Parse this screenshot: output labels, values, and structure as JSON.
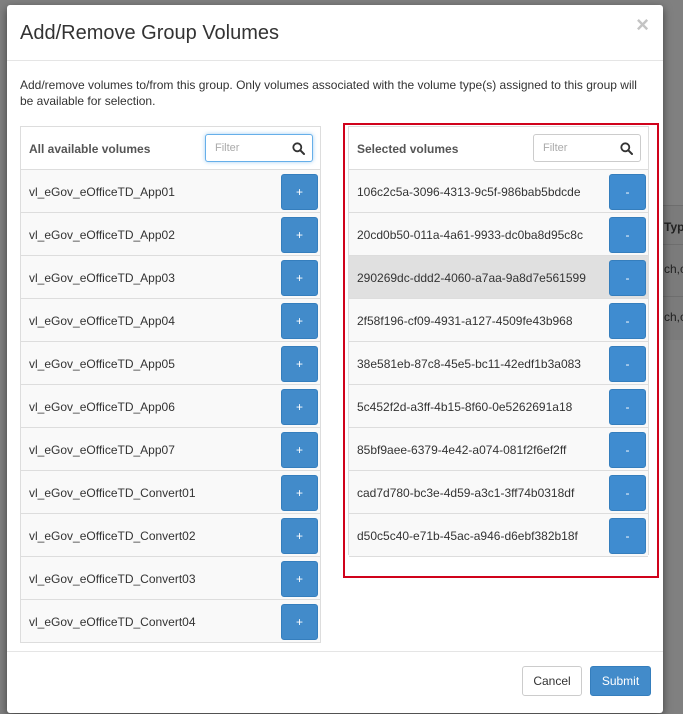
{
  "background": {
    "column_header": "Type",
    "cell_1": "ch,c",
    "cell_2": "ch,c"
  },
  "modal": {
    "title": "Add/Remove Group Volumes",
    "close_symbol": "×",
    "description": "Add/remove volumes to/from this group. Only volumes associated with the volume type(s) assigned to this group will be available for selection."
  },
  "available": {
    "title": "All available volumes",
    "filter_placeholder": "Filter",
    "add_label": "+",
    "items": [
      {
        "label": "vl_eGov_eOfficeTD_App01"
      },
      {
        "label": "vl_eGov_eOfficeTD_App02"
      },
      {
        "label": "vl_eGov_eOfficeTD_App03"
      },
      {
        "label": "vl_eGov_eOfficeTD_App04"
      },
      {
        "label": "vl_eGov_eOfficeTD_App05"
      },
      {
        "label": "vl_eGov_eOfficeTD_App06"
      },
      {
        "label": "vl_eGov_eOfficeTD_App07"
      },
      {
        "label": "vl_eGov_eOfficeTD_Convert01"
      },
      {
        "label": "vl_eGov_eOfficeTD_Convert02"
      },
      {
        "label": "vl_eGov_eOfficeTD_Convert03"
      },
      {
        "label": "vl_eGov_eOfficeTD_Convert04"
      }
    ]
  },
  "selected": {
    "title": "Selected volumes",
    "filter_placeholder": "Filter",
    "remove_label": "-",
    "items": [
      {
        "label": "106c2c5a-3096-4313-9c5f-986bab5bdcde"
      },
      {
        "label": "20cd0b50-011a-4a61-9933-dc0ba8d95c8c"
      },
      {
        "label": "290269dc-ddd2-4060-a7aa-9a8d7e561599",
        "highlighted": true
      },
      {
        "label": "2f58f196-cf09-4931-a127-4509fe43b968"
      },
      {
        "label": "38e581eb-87c8-45e5-bc11-42edf1b3a083"
      },
      {
        "label": "5c452f2d-a3ff-4b15-8f60-0e5262691a18"
      },
      {
        "label": "85bf9aee-6379-4e42-a074-081f2f6ef2ff"
      },
      {
        "label": "cad7d780-bc3e-4d59-a3c1-3ff74b0318df"
      },
      {
        "label": "d50c5c40-e71b-45ac-a946-d6ebf382b18f"
      }
    ]
  },
  "footer": {
    "cancel_label": "Cancel",
    "submit_label": "Submit"
  },
  "colors": {
    "primary": "#428bca",
    "highlight_border": "#d0021b",
    "row_highlight": "#e0e0e0"
  }
}
